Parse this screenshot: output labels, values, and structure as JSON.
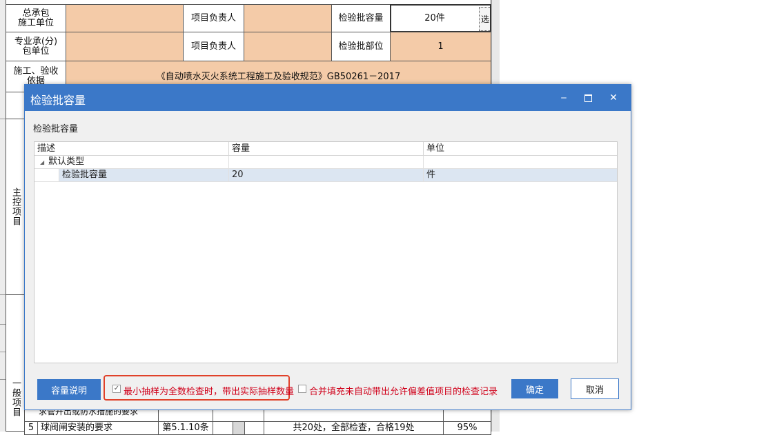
{
  "sheet": {
    "row1_label": "总承包\n施工单位",
    "row1_mid": "项目负责人",
    "row1_right_label": "检验批容量",
    "row1_value": "20件",
    "row1_select": "选",
    "row2_label": "专业承(分)\n包单位",
    "row2_mid": "项目负责人",
    "row2_right_label": "检验批部位",
    "row2_value": "1",
    "row3_label": "施工、验收\n依据",
    "row3_value": "《自动喷水灭火系统工程施工及验收规范》GB50261－2017",
    "main_control_label": "主控项目",
    "general_label": "一般项目",
    "bottom_row_num": "5",
    "bottom_row_text": "球阀闸安装的要求",
    "bottom_row_clause": "第5.1.10条",
    "bottom_row_check": "共20处，全部检查，合格19处",
    "bottom_row_rate": "95%",
    "partial_row_text": "求管开出或防水措施的要求"
  },
  "dialog": {
    "title": "检验批容量",
    "minimize": "‒",
    "maximize": "☐",
    "close": "✕",
    "section_label": "检验批容量",
    "columns": [
      "描述",
      "容量",
      "单位"
    ],
    "group_row": {
      "label": "默认类型"
    },
    "data_row": {
      "desc": "检验批容量",
      "capacity": "20",
      "unit": "件"
    },
    "btn_capacity_info": "容量说明",
    "chk1_label": "最小抽样为全数检查时，带出实际抽样数量",
    "chk1_checked": true,
    "chk2_label": "合并填充未自动带出允许偏差值项目的检查记录",
    "chk2_checked": false,
    "btn_ok": "确定",
    "btn_cancel": "取消"
  },
  "colors": {
    "accent": "#3b78c8",
    "peach": "#f4cba8",
    "warning": "#d0021b"
  }
}
